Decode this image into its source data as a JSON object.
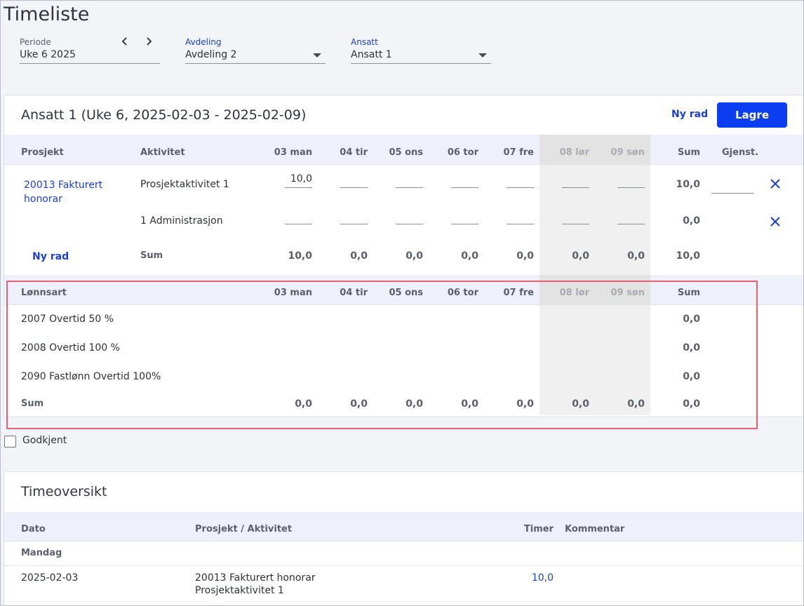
{
  "page": {
    "title": "Timeliste"
  },
  "filters": {
    "periode": {
      "label": "Periode",
      "value": "Uke 6 2025"
    },
    "avdeling": {
      "label": "Avdeling",
      "value": "Avdeling 2"
    },
    "ansatt": {
      "label": "Ansatt",
      "value": "Ansatt 1"
    }
  },
  "timesheet": {
    "title": "Ansatt 1 (Uke 6, 2025-02-03 - 2025-02-09)",
    "new_row_label": "Ny rad",
    "save_label": "Lagre",
    "headers": {
      "project": "Prosjekt",
      "activity": "Aktivitet",
      "sum": "Sum",
      "remaining": "Gjenst."
    },
    "days": [
      "03 man",
      "04 tir",
      "05 ons",
      "06 tor",
      "07 fre",
      "08 lør",
      "09 søn"
    ],
    "rows": [
      {
        "project": "20013 Fakturert honorar",
        "activity": "Prosjektaktivitet 1",
        "hours": [
          "10,0",
          "",
          "",
          "",
          "",
          "",
          ""
        ],
        "sum": "10,0"
      },
      {
        "project": "",
        "activity": "1 Administrasjon",
        "hours": [
          "",
          "",
          "",
          "",
          "",
          "",
          ""
        ],
        "sum": "0,0"
      }
    ],
    "footer": {
      "new_row_label": "Ny rad",
      "sum_label": "Sum",
      "values": [
        "10,0",
        "0,0",
        "0,0",
        "0,0",
        "0,0",
        "0,0",
        "0,0"
      ],
      "sum": "10,0"
    }
  },
  "wages": {
    "header_label": "Lønnsart",
    "sum_header": "Sum",
    "rows": [
      {
        "name": "2007 Overtid 50 %",
        "sum": "0,0"
      },
      {
        "name": "2008 Overtid 100 %",
        "sum": "0,0"
      },
      {
        "name": "2090 Fastlønn Overtid 100%",
        "sum": "0,0"
      }
    ],
    "footer": {
      "label": "Sum",
      "values": [
        "0,0",
        "0,0",
        "0,0",
        "0,0",
        "0,0",
        "0,0",
        "0,0"
      ],
      "sum": "0,0"
    }
  },
  "approved": {
    "label": "Godkjent",
    "checked": false
  },
  "overview": {
    "title": "Timeoversikt",
    "headers": {
      "date": "Dato",
      "project_activity": "Prosjekt / Aktivitet",
      "hours": "Timer",
      "comment": "Kommentar"
    },
    "group": "Mandag",
    "entries": [
      {
        "date": "2025-02-03",
        "project": "20013 Fakturert honorar",
        "activity": "Prosjektaktivitet 1",
        "hours": "10,0",
        "comment": ""
      }
    ]
  },
  "colors": {
    "accent": "#0a3ef0",
    "link": "#1a3fd6",
    "highlight_border": "#e4606e",
    "weekend_bg": "#f0f0f0"
  },
  "icons": {
    "prev": "chevron-left-icon",
    "next": "chevron-right-icon",
    "dropdown": "caret-down-icon",
    "delete": "close-icon"
  }
}
